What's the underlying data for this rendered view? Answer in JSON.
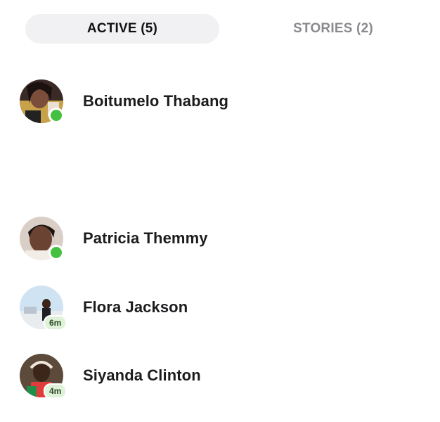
{
  "tabs": {
    "active": "ACTIVE (5)",
    "stories": "STORIES (2)"
  },
  "contacts": [
    {
      "name": "Boitumelo Thabang",
      "status": "online",
      "badge": ""
    },
    {
      "name": "Patricia Themmy",
      "status": "online",
      "badge": ""
    },
    {
      "name": "Flora Jackson",
      "status": "recent",
      "badge": "6m"
    },
    {
      "name": "Siyanda Clinton",
      "status": "recent",
      "badge": "4m"
    }
  ],
  "colors": {
    "online": "#44c140",
    "badge_bg": "#dff2d9",
    "active_tab_bg": "#f1f1f3",
    "inactive_tab_text": "#8a8a8e"
  }
}
